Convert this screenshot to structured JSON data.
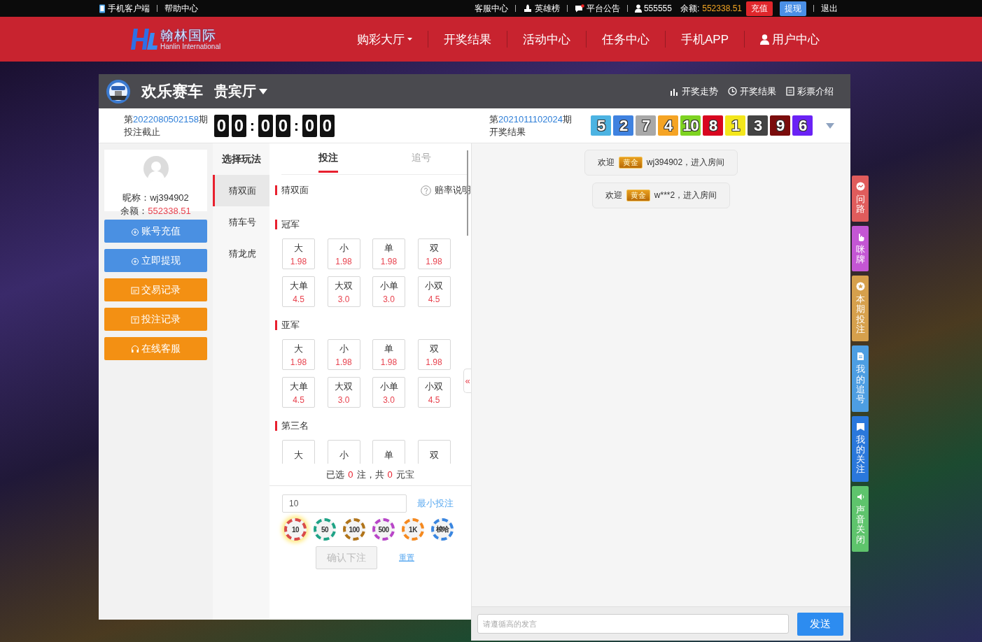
{
  "top_bar": {
    "client_link": "手机客户端",
    "help_link": "帮助中心",
    "service_link": "客服中心",
    "heroes_link": "英雄榜",
    "notice_link": "平台公告",
    "username": "555555",
    "balance_label": "余额:",
    "balance": "552338.51",
    "recharge_button": "充值",
    "withdraw_button": "提现",
    "logout_link": "退出"
  },
  "nav": {
    "logo_text": "翰林国际",
    "logo_subtitle": "Hanlin International",
    "items": [
      {
        "label": "购彩大厅",
        "kind": "menu"
      },
      {
        "label": "开奖结果",
        "kind": "link"
      },
      {
        "label": "活动中心",
        "kind": "link"
      },
      {
        "label": "任务中心",
        "kind": "link"
      },
      {
        "label": "手机APP",
        "kind": "link"
      },
      {
        "label": "用户中心",
        "kind": "user"
      }
    ]
  },
  "game": {
    "title": "欢乐赛车",
    "room": "贵宾厅",
    "links": [
      {
        "label": "开奖走势",
        "kind": "trend"
      },
      {
        "label": "开奖结果",
        "kind": "history"
      },
      {
        "label": "彩票介绍",
        "kind": "info"
      }
    ]
  },
  "current_draw": {
    "prefix": "第",
    "number": "2022080502158",
    "suffix": "期",
    "status": "投注截止",
    "countdown": [
      [
        "0",
        "0"
      ],
      [
        "0",
        "0"
      ],
      [
        "0",
        "0"
      ]
    ],
    "separator": ":"
  },
  "last_draw": {
    "prefix": "第",
    "number": "2021011102024",
    "suffix": "期",
    "label": "开奖结果",
    "balls": [
      {
        "value": "5",
        "color": "#4cb3e2"
      },
      {
        "value": "2",
        "color": "#3f82e0"
      },
      {
        "value": "7",
        "color": "#a8a8a8"
      },
      {
        "value": "4",
        "color": "#f5a424"
      },
      {
        "value": "10",
        "color": "#7ed321"
      },
      {
        "value": "8",
        "color": "#d8061f"
      },
      {
        "value": "1",
        "color": "#f3e61c"
      },
      {
        "value": "3",
        "color": "#444444"
      },
      {
        "value": "9",
        "color": "#7a0c0c"
      },
      {
        "value": "6",
        "color": "#6a22f5"
      }
    ]
  },
  "user": {
    "nickname_label": "昵称：",
    "nickname": "wj394902",
    "balance_label": "余额：",
    "balance": "552338.51"
  },
  "side_buttons": [
    {
      "label": "账号充值",
      "kind": "deposit",
      "color": "#4a90e2"
    },
    {
      "label": "立即提现",
      "kind": "withdraw",
      "color": "#4a90e2"
    },
    {
      "label": "交易记录",
      "kind": "transactions",
      "color": "#f39013"
    },
    {
      "label": "投注记录",
      "kind": "bets",
      "color": "#f39013"
    },
    {
      "label": "在线客服",
      "kind": "support",
      "color": "#f39013"
    }
  ],
  "play_types": {
    "title": "选择玩法",
    "items": [
      {
        "label": "猜双面",
        "selected": true
      },
      {
        "label": "猜车号",
        "selected": false
      },
      {
        "label": "猜龙虎",
        "selected": false
      }
    ]
  },
  "bet": {
    "tabs": [
      {
        "label": "投注",
        "selected": true
      },
      {
        "label": "追号",
        "selected": false
      }
    ],
    "section_title": "猜双面",
    "odds_help": "赔率说明",
    "groups": [
      {
        "title": "冠军",
        "options": [
          {
            "label": "大",
            "odds": "1.98"
          },
          {
            "label": "小",
            "odds": "1.98"
          },
          {
            "label": "单",
            "odds": "1.98"
          },
          {
            "label": "双",
            "odds": "1.98"
          },
          {
            "label": "大单",
            "odds": "4.5"
          },
          {
            "label": "大双",
            "odds": "3.0"
          },
          {
            "label": "小单",
            "odds": "3.0"
          },
          {
            "label": "小双",
            "odds": "4.5"
          }
        ]
      },
      {
        "title": "亚军",
        "options": [
          {
            "label": "大",
            "odds": "1.98"
          },
          {
            "label": "小",
            "odds": "1.98"
          },
          {
            "label": "单",
            "odds": "1.98"
          },
          {
            "label": "双",
            "odds": "1.98"
          },
          {
            "label": "大单",
            "odds": "4.5"
          },
          {
            "label": "大双",
            "odds": "3.0"
          },
          {
            "label": "小单",
            "odds": "3.0"
          },
          {
            "label": "小双",
            "odds": "4.5"
          }
        ]
      },
      {
        "title": "第三名",
        "options": [
          {
            "label": "大"
          },
          {
            "label": "小"
          },
          {
            "label": "单"
          },
          {
            "label": "双"
          }
        ]
      }
    ],
    "summary": {
      "prefix": "已选",
      "count": "0",
      "middle": "注，共",
      "total": "0",
      "suffix": "元宝"
    },
    "amount": "10",
    "min_bet_link": "最小投注",
    "chips": [
      {
        "label": "10",
        "selected": true,
        "color": "#d94a4a"
      },
      {
        "label": "50",
        "selected": false,
        "color": "#1fa386"
      },
      {
        "label": "100",
        "selected": false,
        "color": "#b0741a"
      },
      {
        "label": "500",
        "selected": false,
        "color": "#b845c8"
      },
      {
        "label": "1K",
        "selected": false,
        "color": "#f5891f"
      },
      {
        "label": "梭哈",
        "selected": false,
        "color": "#3a86e0"
      }
    ],
    "confirm": {
      "label": "确认下注",
      "disabled": true
    },
    "reset_link": "重置",
    "collapse_toggle": "«"
  },
  "chat": {
    "messages": [
      {
        "prefix": "欢迎",
        "badge": "黄金",
        "text": "wj394902，进入房间"
      },
      {
        "prefix": "欢迎",
        "badge": "黄金",
        "text": "w***2，进入房间"
      }
    ],
    "placeholder": "请遵循高的发言",
    "send_button": "发送"
  },
  "float_tabs": [
    {
      "label": "问路",
      "kind": "road",
      "color": "#e05c5c"
    },
    {
      "label": "咪牌",
      "kind": "hand",
      "color": "#c456d4"
    },
    {
      "label": "本期投注",
      "kind": "star",
      "color": "#d6a04c"
    },
    {
      "label": "我的追号",
      "kind": "doc",
      "color": "#4d9ee2"
    },
    {
      "label": "我的关注",
      "kind": "bookmark",
      "color": "#2a78dc"
    },
    {
      "label": "声音关闭",
      "kind": "sound",
      "color": "#5ec46c"
    }
  ]
}
